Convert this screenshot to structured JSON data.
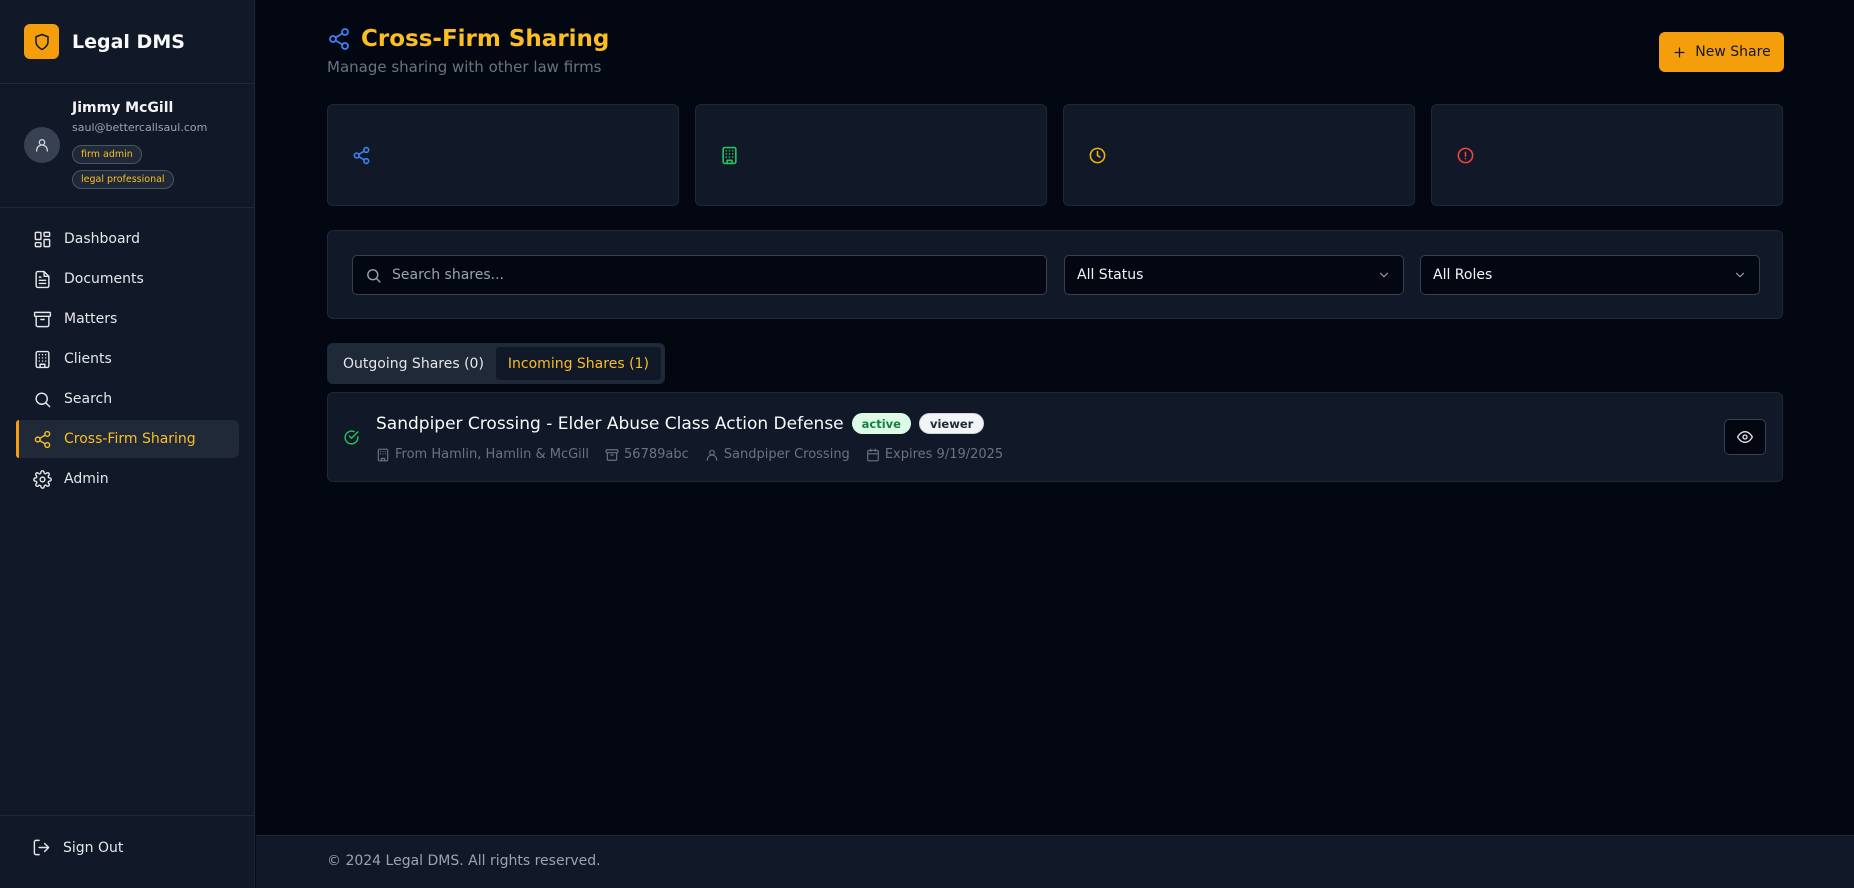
{
  "brand": {
    "name": "Legal DMS",
    "logo_icon": "shield-icon",
    "logo_color": "#f59e0b"
  },
  "user": {
    "name": "Jimmy McGill",
    "email": "saul@bettercallsaul.com",
    "roles": [
      "firm admin",
      "legal professional"
    ]
  },
  "nav": [
    {
      "label": "Dashboard",
      "icon": "dashboard-icon",
      "active": false
    },
    {
      "label": "Documents",
      "icon": "document-icon",
      "active": false
    },
    {
      "label": "Matters",
      "icon": "archive-icon",
      "active": false
    },
    {
      "label": "Clients",
      "icon": "building-icon",
      "active": false
    },
    {
      "label": "Search",
      "icon": "search-icon",
      "active": false
    },
    {
      "label": "Cross-Firm Sharing",
      "icon": "share-icon",
      "active": true
    },
    {
      "label": "Admin",
      "icon": "gear-icon",
      "active": false
    }
  ],
  "sign_out": "Sign Out",
  "header": {
    "title": "Cross-Firm Sharing",
    "subtitle": "Manage sharing with other law firms",
    "new_share_label": "New Share"
  },
  "stat_cards": [
    {
      "icon": "share-icon",
      "color": "#3b82f6"
    },
    {
      "icon": "building-icon",
      "color": "#22c55e"
    },
    {
      "icon": "clock-icon",
      "color": "#eab308"
    },
    {
      "icon": "alert-circle-icon",
      "color": "#ef4444"
    }
  ],
  "filters": {
    "search_placeholder": "Search shares...",
    "status_selected": "All Status",
    "roles_selected": "All Roles"
  },
  "tabs": [
    {
      "label": "Outgoing Shares (0)",
      "active": false
    },
    {
      "label": "Incoming Shares (1)",
      "active": true
    }
  ],
  "shares": [
    {
      "title": "Sandpiper Crossing - Elder Abuse Class Action Defense",
      "status": "active",
      "role": "viewer",
      "from": "From Hamlin, Hamlin & McGill",
      "matter": "56789abc",
      "client": "Sandpiper Crossing",
      "expires": "Expires 9/19/2025"
    }
  ],
  "footer": "© 2024 Legal DMS. All rights reserved."
}
